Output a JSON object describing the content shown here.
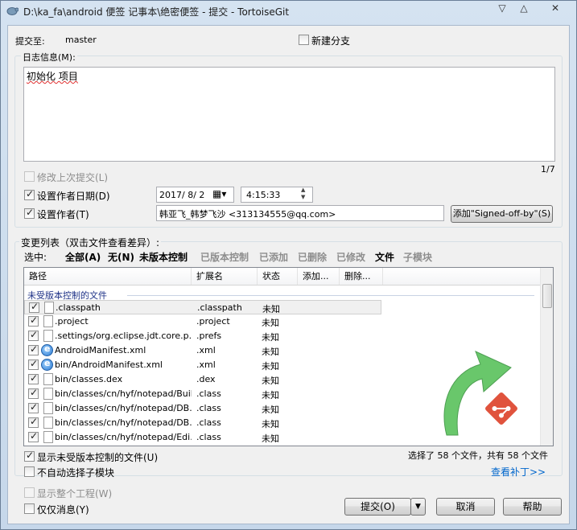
{
  "window": {
    "title": "D:\\ka_fa\\android 便签 记事本\\绝密便签 - 提交 - TortoiseGit",
    "minimize": "▽",
    "maximize": "△",
    "close": "✕"
  },
  "commit_to": {
    "label": "提交至:",
    "branch": "master"
  },
  "new_branch": {
    "label": "新建分支",
    "checked": false
  },
  "log": {
    "label": "日志信息(M):",
    "message": "初始化 项目",
    "counter": "1/7"
  },
  "amend": {
    "label": "修改上次提交(L)",
    "checked": false,
    "disabled": true
  },
  "author_date": {
    "label": "设置作者日期(D)",
    "checked": true,
    "date": "2017/ 8/ 2",
    "time": "4:15:33"
  },
  "author": {
    "label": "设置作者(T)",
    "checked": true,
    "value": "韩亚飞_韩梦飞沙 <313134555@qq.com>"
  },
  "signed_off_button": "添加\"Signed-off-by\"(S)",
  "changes": {
    "label": "变更列表（双击文件查看差异）:",
    "select_label": "选中:",
    "filters": [
      "全部(A)",
      "无(N)",
      "未版本控制",
      "已版本控制",
      "已添加",
      "已删除",
      "已修改",
      "文件",
      "子模块"
    ],
    "columns": [
      "路径",
      "扩展名",
      "状态",
      "添加...",
      "删除..."
    ],
    "group_title": "未受版本控制的文件",
    "rows": [
      {
        "path": ".classpath",
        "ext": ".classpath",
        "status": "未知",
        "icon": "file-icon"
      },
      {
        "path": ".project",
        "ext": ".project",
        "status": "未知",
        "icon": "file-icon"
      },
      {
        "path": ".settings/org.eclipse.jdt.core.p...",
        "ext": ".prefs",
        "status": "未知",
        "icon": "file-icon"
      },
      {
        "path": "AndroidManifest.xml",
        "ext": ".xml",
        "status": "未知",
        "icon": "ie-xml-icon"
      },
      {
        "path": "bin/AndroidManifest.xml",
        "ext": ".xml",
        "status": "未知",
        "icon": "ie-xml-icon"
      },
      {
        "path": "bin/classes.dex",
        "ext": ".dex",
        "status": "未知",
        "icon": "file-icon"
      },
      {
        "path": "bin/classes/cn/hyf/notepad/Buil...",
        "ext": ".class",
        "status": "未知",
        "icon": "file-icon"
      },
      {
        "path": "bin/classes/cn/hyf/notepad/DB...",
        "ext": ".class",
        "status": "未知",
        "icon": "file-icon"
      },
      {
        "path": "bin/classes/cn/hyf/notepad/DB...",
        "ext": ".class",
        "status": "未知",
        "icon": "file-icon"
      },
      {
        "path": "bin/classes/cn/hyf/notepad/Edi...",
        "ext": ".class",
        "status": "未知",
        "icon": "file-icon"
      }
    ]
  },
  "selection_summary": "选择了 58 个文件，共有 58 个文件",
  "show_unversioned": {
    "label": "显示未受版本控制的文件(U)",
    "checked": true
  },
  "no_auto_submodule": {
    "label": "不自动选择子模块",
    "checked": false
  },
  "view_patch": "查看补丁>>",
  "show_whole_project": {
    "label": "显示整个工程(W)",
    "checked": false,
    "disabled": true
  },
  "message_only": {
    "label": "仅仅消息(Y)",
    "checked": false
  },
  "buttons": {
    "commit": "提交(O)",
    "cancel": "取消",
    "help": "帮助"
  },
  "colors": {
    "titlebar": "#c6d7ea",
    "group_text": "#1e3287",
    "link": "#0066cc",
    "logo_green": "#3cb043",
    "git_red": "#e0533d"
  }
}
